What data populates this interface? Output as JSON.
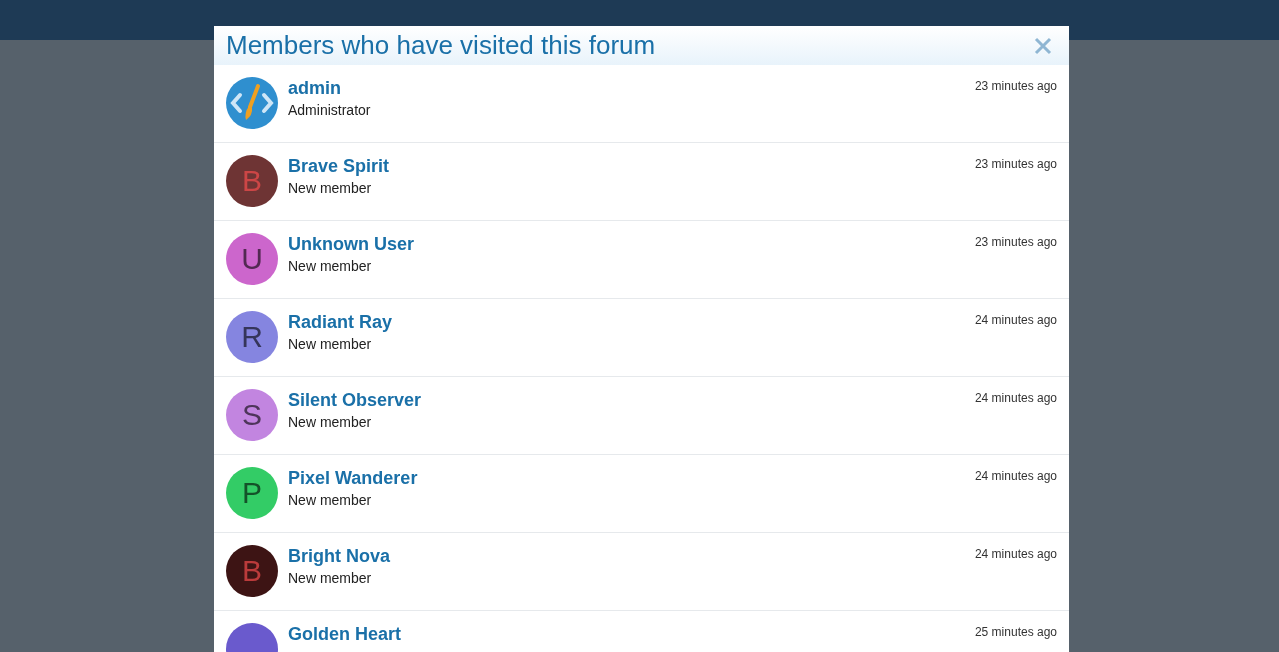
{
  "dialog": {
    "title": "Members who have visited this forum",
    "members": [
      {
        "name": "admin",
        "role": "Administrator",
        "time": "23 minutes ago",
        "avatar": {
          "kind": "logo",
          "color": "#2f8fcf"
        }
      },
      {
        "name": "Brave Spirit",
        "role": "New member",
        "time": "23 minutes ago",
        "avatar": {
          "kind": "letter",
          "letter": "B",
          "color": "#6e3434"
        }
      },
      {
        "name": "Unknown User",
        "role": "New member",
        "time": "23 minutes ago",
        "avatar": {
          "kind": "letter",
          "letter": "U",
          "color": "#cc66cc"
        }
      },
      {
        "name": "Radiant Ray",
        "role": "New member",
        "time": "24 minutes ago",
        "avatar": {
          "kind": "letter",
          "letter": "R",
          "color": "#8585e0"
        }
      },
      {
        "name": "Silent Observer",
        "role": "New member",
        "time": "24 minutes ago",
        "avatar": {
          "kind": "letter",
          "letter": "S",
          "color": "#c285e0"
        }
      },
      {
        "name": "Pixel Wanderer",
        "role": "New member",
        "time": "24 minutes ago",
        "avatar": {
          "kind": "letter",
          "letter": "P",
          "color": "#33cc66"
        }
      },
      {
        "name": "Bright Nova",
        "role": "New member",
        "time": "24 minutes ago",
        "avatar": {
          "kind": "letter",
          "letter": "B",
          "color": "#3d1414"
        }
      },
      {
        "name": "Golden Heart",
        "time": "25 minutes ago",
        "avatar": {
          "kind": "letter",
          "color": "#6a5acd"
        }
      }
    ]
  }
}
